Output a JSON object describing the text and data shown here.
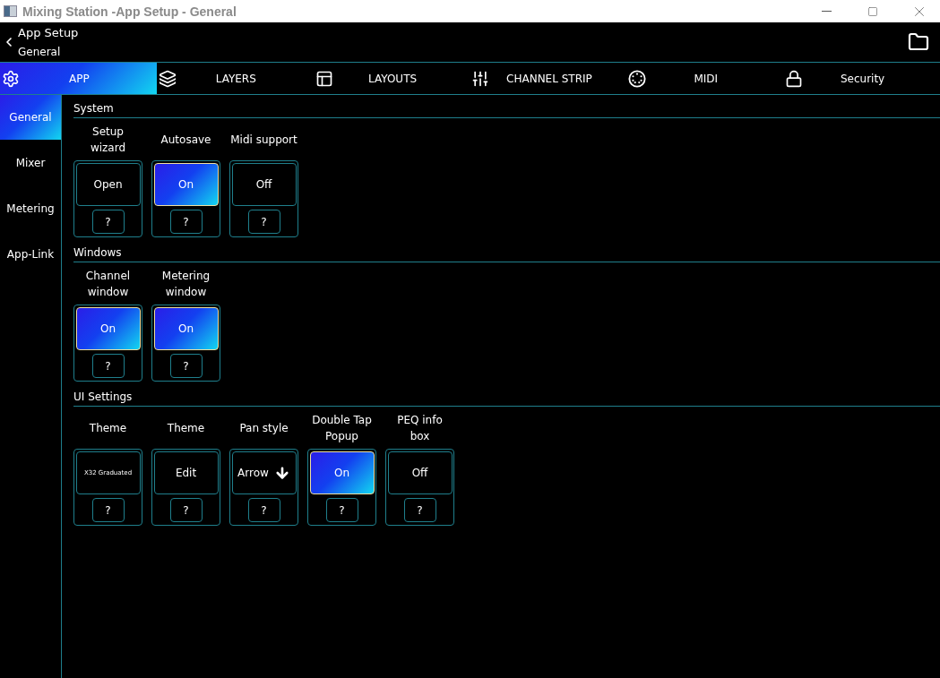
{
  "window": {
    "title": "Mixing Station -App Setup - General"
  },
  "header": {
    "title": "App Setup",
    "subtitle": "General"
  },
  "tabs": [
    {
      "label": "APP",
      "selected": true
    },
    {
      "label": "LAYERS",
      "selected": false
    },
    {
      "label": "LAYOUTS",
      "selected": false
    },
    {
      "label": "CHANNEL STRIP",
      "selected": false
    },
    {
      "label": "MIDI",
      "selected": false
    },
    {
      "label": "Security",
      "selected": false
    }
  ],
  "sidebar": {
    "items": [
      {
        "label": "General",
        "selected": true
      },
      {
        "label": "Mixer",
        "selected": false
      },
      {
        "label": "Metering",
        "selected": false
      },
      {
        "label": "App-Link",
        "selected": false
      }
    ]
  },
  "sections": [
    {
      "title": "System",
      "settings": [
        {
          "label": "Setup wizard",
          "kind": "action",
          "value": "Open",
          "help": "?"
        },
        {
          "label": "Autosave",
          "kind": "toggle",
          "value": "On",
          "on": true,
          "help": "?"
        },
        {
          "label": "Midi support",
          "kind": "toggle",
          "value": "Off",
          "on": false,
          "help": "?"
        }
      ]
    },
    {
      "title": "Windows",
      "settings": [
        {
          "label": "Channel window",
          "kind": "toggle",
          "value": "On",
          "on": true,
          "help": "?"
        },
        {
          "label": "Metering window",
          "kind": "toggle",
          "value": "On",
          "on": true,
          "help": "?"
        }
      ]
    },
    {
      "title": "UI Settings",
      "settings": [
        {
          "label": "Theme",
          "kind": "preset",
          "value": "X32 Graduated",
          "help": "?"
        },
        {
          "label": "Theme",
          "kind": "action",
          "value": "Edit",
          "help": "?"
        },
        {
          "label": "Pan style",
          "kind": "dropdown",
          "value": "Arrow",
          "help": "?"
        },
        {
          "label": "Double Tap Popup",
          "kind": "toggle",
          "value": "On",
          "on": true,
          "help": "?"
        },
        {
          "label": "PEQ info box",
          "kind": "toggle",
          "value": "Off",
          "on": false,
          "help": "?"
        }
      ]
    }
  ]
}
